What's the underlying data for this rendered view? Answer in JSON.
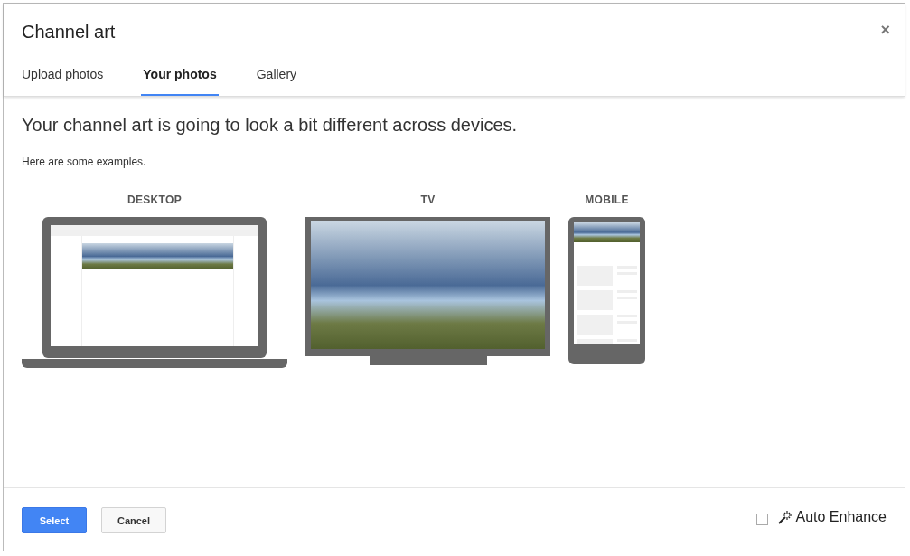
{
  "dialog": {
    "title": "Channel art",
    "close": "×"
  },
  "tabs": [
    {
      "label": "Upload photos",
      "selected": false
    },
    {
      "label": "Your photos",
      "selected": true
    },
    {
      "label": "Gallery",
      "selected": false
    }
  ],
  "heading": "Your channel art is going to look a bit different across devices.",
  "subtext": "Here are some examples.",
  "devices": [
    {
      "label": "DESKTOP",
      "kind": "laptop"
    },
    {
      "label": "TV",
      "kind": "tv"
    },
    {
      "label": "MOBILE",
      "kind": "phone"
    }
  ],
  "buttons": [
    {
      "label": "Select",
      "kind": "primary"
    },
    {
      "label": "Cancel",
      "kind": "secondary"
    }
  ],
  "auto_enhance": {
    "label": "Auto Enhance",
    "checked": false
  }
}
